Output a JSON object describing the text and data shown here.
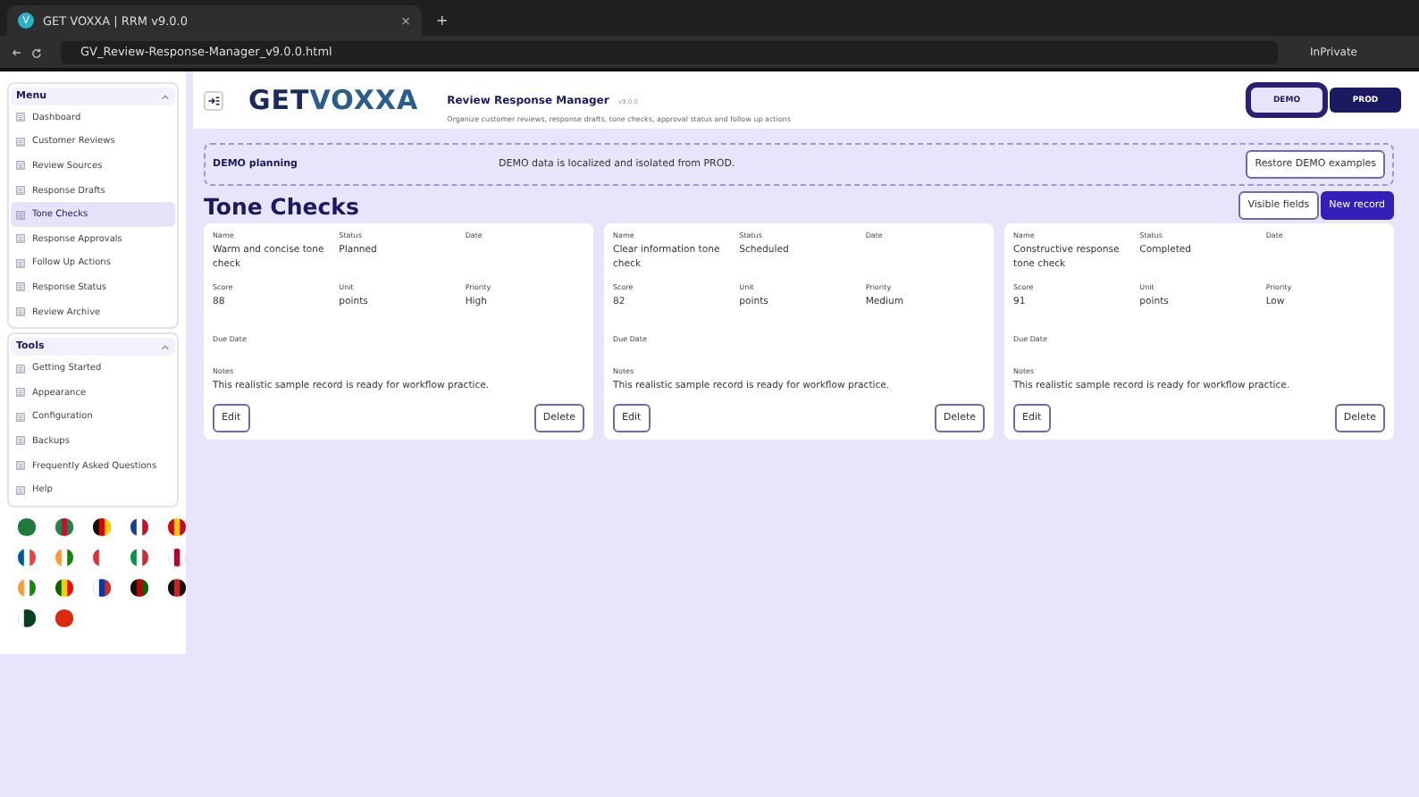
{
  "browser": {
    "tab_title": "GET VOXXA | RRM v9.0.0",
    "tab_icon": "V",
    "new_tab": "+",
    "close_tab": "×",
    "address": "GV_Review-Response-Manager_v9.0.0.html",
    "profile": "InPrivate"
  },
  "sidebar": {
    "sections": [
      {
        "title": "Menu",
        "items": [
          {
            "label": "Dashboard",
            "selected": false
          },
          {
            "label": "Customer Reviews",
            "selected": false
          },
          {
            "label": "Review Sources",
            "selected": false
          },
          {
            "label": "Response Drafts",
            "selected": false
          },
          {
            "label": "Tone Checks",
            "selected": true
          },
          {
            "label": "Response Approvals",
            "selected": false
          },
          {
            "label": "Follow Up Actions",
            "selected": false
          },
          {
            "label": "Response Status",
            "selected": false
          },
          {
            "label": "Review Archive",
            "selected": false
          }
        ]
      },
      {
        "title": "Tools",
        "items": [
          {
            "label": "Getting Started",
            "selected": false
          },
          {
            "label": "Appearance",
            "selected": false
          },
          {
            "label": "Configuration",
            "selected": false
          },
          {
            "label": "Backups",
            "selected": false
          },
          {
            "label": "Frequently Asked Questions",
            "selected": false
          },
          {
            "label": "Help",
            "selected": false
          }
        ]
      }
    ]
  },
  "header": {
    "logo_a": "GET",
    "logo_b": "VOXXA",
    "title": "Review Response Manager",
    "version": "v9.0.0",
    "subtitle": "Organize customer reviews, response drafts, tone checks, approval status and follow up actions",
    "modes": [
      {
        "label": "DEMO",
        "selected": true
      },
      {
        "label": "PROD",
        "selected": false
      }
    ]
  },
  "banner": {
    "title": "DEMO planning",
    "message": "DEMO data is localized and isolated from PROD.",
    "button": "Restore DEMO examples"
  },
  "page": {
    "title": "Tone Checks",
    "actions": [
      {
        "label": "Visible fields",
        "kind": "secondary"
      },
      {
        "label": "New record",
        "kind": "primary"
      }
    ]
  },
  "records": [
    {
      "fields": [
        {
          "label": "Name",
          "value": "Warm and concise tone check"
        },
        {
          "label": "Status",
          "value": "Planned"
        },
        {
          "label": "Date"
        },
        {
          "label": "Score",
          "value": "88"
        },
        {
          "label": "Unit",
          "value": "points"
        },
        {
          "label": "Priority",
          "value": "High"
        }
      ],
      "due_label": "Due Date",
      "notes_label": "Notes",
      "notes": "This realistic sample record is ready for workflow practice.",
      "edit": "Edit",
      "delete": "Delete"
    },
    {
      "fields": [
        {
          "label": "Name",
          "value": "Clear information tone check"
        },
        {
          "label": "Status",
          "value": "Scheduled"
        },
        {
          "label": "Date"
        },
        {
          "label": "Score",
          "value": "82"
        },
        {
          "label": "Unit",
          "value": "points"
        },
        {
          "label": "Priority",
          "value": "Medium"
        }
      ],
      "due_label": "Due Date",
      "notes_label": "Notes",
      "notes": "This realistic sample record is ready for workflow practice.",
      "edit": "Edit",
      "delete": "Delete"
    },
    {
      "fields": [
        {
          "label": "Name",
          "value": "Constructive response tone check"
        },
        {
          "label": "Status",
          "value": "Completed"
        },
        {
          "label": "Date"
        },
        {
          "label": "Score",
          "value": "91"
        },
        {
          "label": "Unit",
          "value": "points"
        },
        {
          "label": "Priority",
          "value": "Low"
        }
      ],
      "due_label": "Due Date",
      "notes_label": "Notes",
      "notes": "This realistic sample record is ready for workflow practice.",
      "edit": "Edit",
      "delete": "Delete"
    }
  ]
}
